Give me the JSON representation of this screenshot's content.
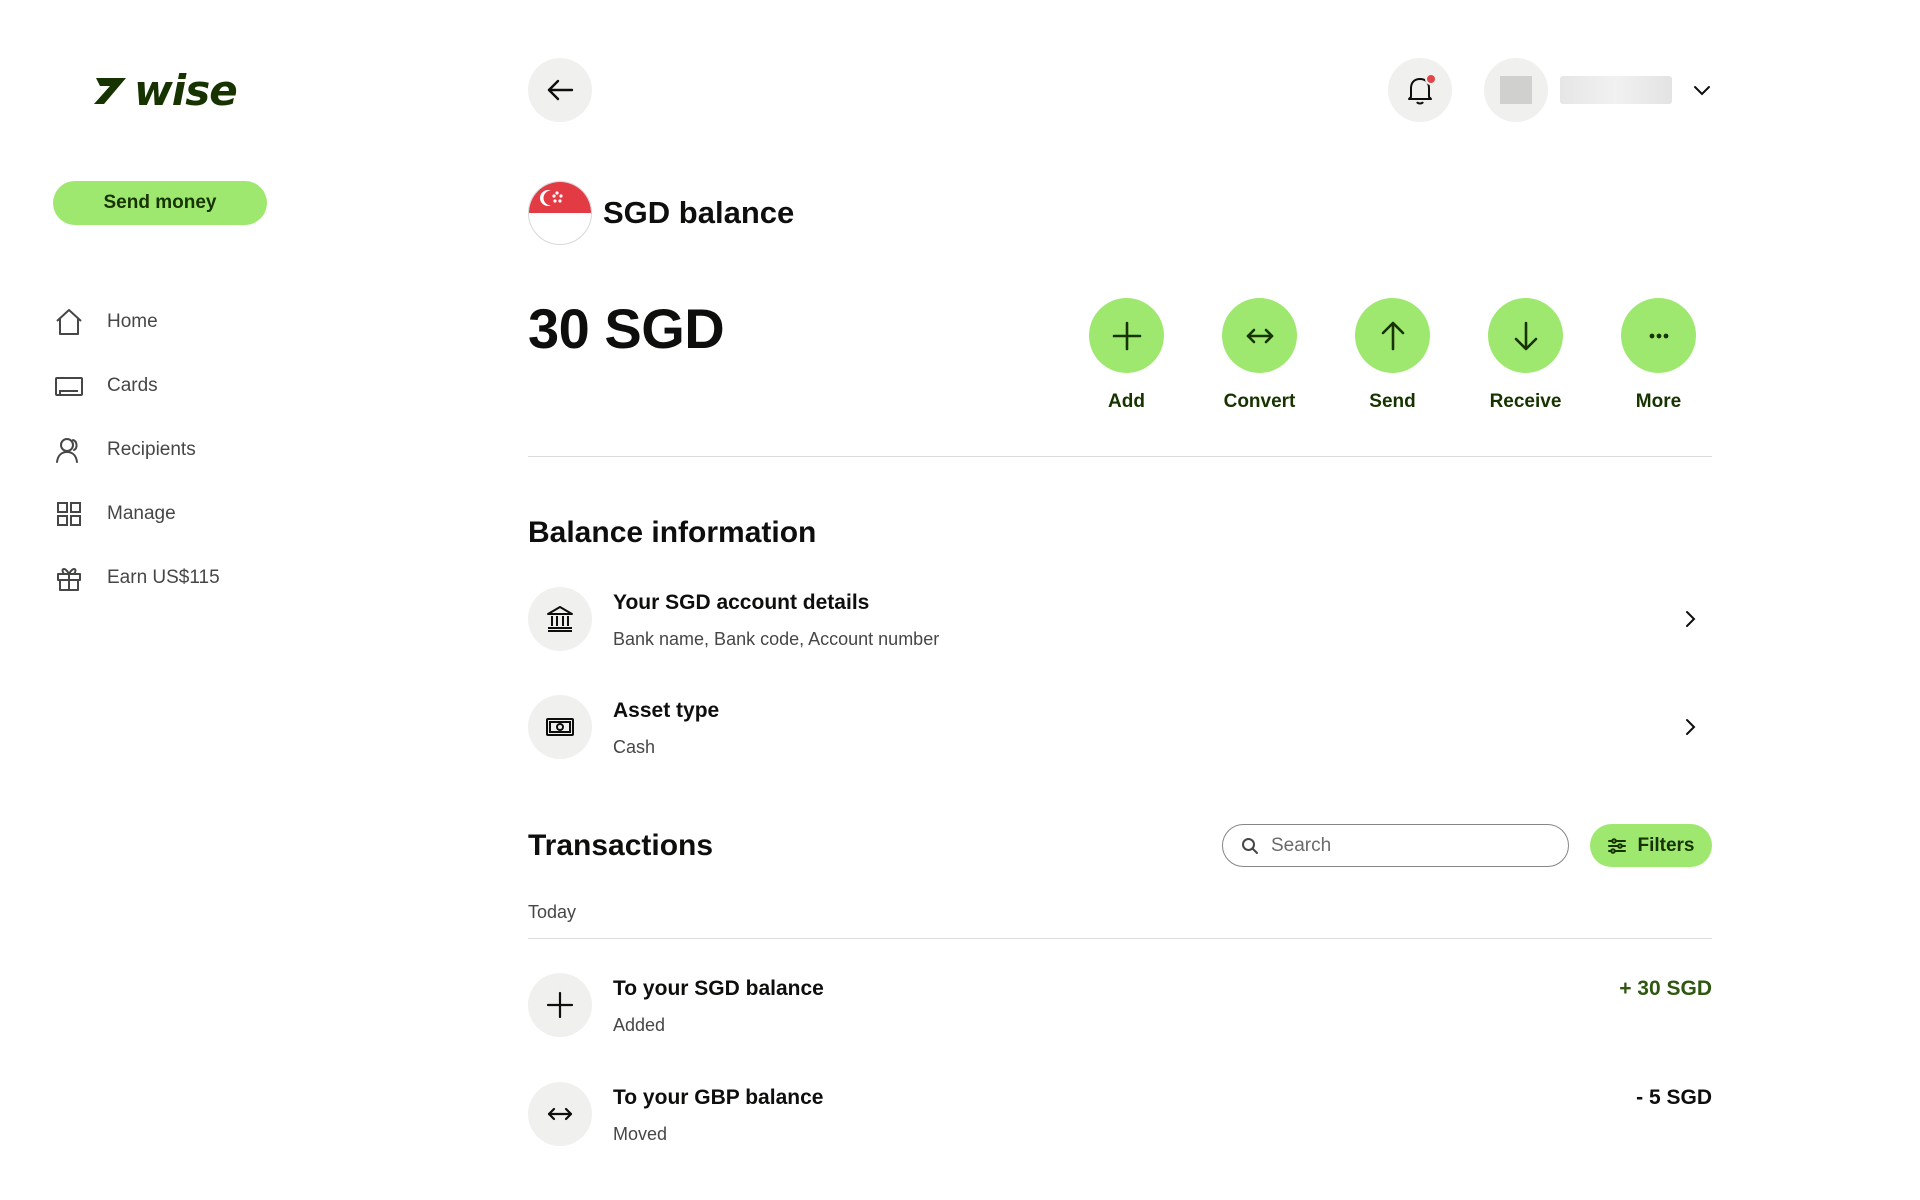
{
  "brand": {
    "name": "wise"
  },
  "sidebar": {
    "send_money_label": "Send money",
    "items": [
      {
        "label": "Home",
        "icon": "home-icon"
      },
      {
        "label": "Cards",
        "icon": "card-icon"
      },
      {
        "label": "Recipients",
        "icon": "recipients-icon"
      },
      {
        "label": "Manage",
        "icon": "grid-icon"
      },
      {
        "label": "Earn US$115",
        "icon": "gift-icon"
      }
    ]
  },
  "header": {
    "back_icon": "arrow-left-icon",
    "notification_icon": "bell-icon",
    "profile_menu_icon": "chevron-down-icon"
  },
  "balance": {
    "currency_flag": "singapore-flag",
    "title": "SGD balance",
    "amount": "30 SGD",
    "actions": [
      {
        "label": "Add",
        "icon": "plus-icon"
      },
      {
        "label": "Convert",
        "icon": "convert-arrows-icon"
      },
      {
        "label": "Send",
        "icon": "arrow-up-icon"
      },
      {
        "label": "Receive",
        "icon": "arrow-down-icon"
      },
      {
        "label": "More",
        "icon": "more-dots-icon"
      }
    ]
  },
  "balance_information": {
    "title": "Balance information",
    "rows": [
      {
        "title": "Your SGD account details",
        "subtitle": "Bank name, Bank code, Account number",
        "icon": "bank-icon"
      },
      {
        "title": "Asset type",
        "subtitle": "Cash",
        "icon": "cash-icon"
      }
    ]
  },
  "transactions": {
    "title": "Transactions",
    "search_placeholder": "Search",
    "filters_label": "Filters",
    "groups": [
      {
        "label": "Today",
        "items": [
          {
            "title": "To your SGD balance",
            "subtitle": "Added",
            "amount": "+ 30 SGD",
            "direction": "positive",
            "icon": "plus-icon"
          },
          {
            "title": "To your GBP balance",
            "subtitle": "Moved",
            "amount": "- 5 SGD",
            "direction": "negative",
            "icon": "convert-arrows-icon"
          }
        ]
      }
    ]
  },
  "colors": {
    "accent_green": "#9fe870",
    "forest_green": "#163300",
    "positive_amount": "#2f5711",
    "notification_dot": "#e0464a"
  }
}
